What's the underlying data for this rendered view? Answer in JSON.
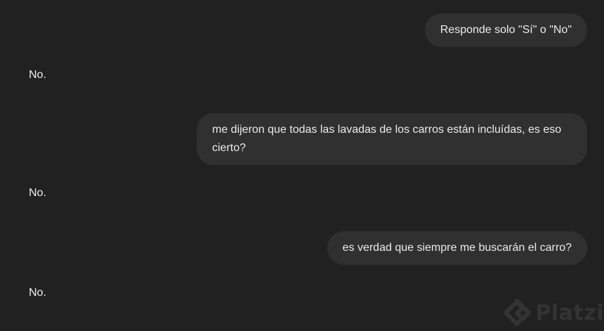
{
  "conversation": {
    "messages": [
      {
        "role": "user",
        "text": "Responde solo \"Sí\" o \"No\""
      },
      {
        "role": "assistant",
        "text": "No."
      },
      {
        "role": "user",
        "text": "me dijeron que todas las lavadas de los carros están incluídas, es eso cierto?"
      },
      {
        "role": "assistant",
        "text": "No."
      },
      {
        "role": "user",
        "text": "es verdad que siempre me buscarán el carro?"
      },
      {
        "role": "assistant",
        "text": "No."
      }
    ]
  },
  "watermark": {
    "brand": "Platzi",
    "icon": "platzi-logo-icon"
  },
  "colors": {
    "background": "#212121",
    "user_bubble": "#303030",
    "text": "#ececec"
  }
}
